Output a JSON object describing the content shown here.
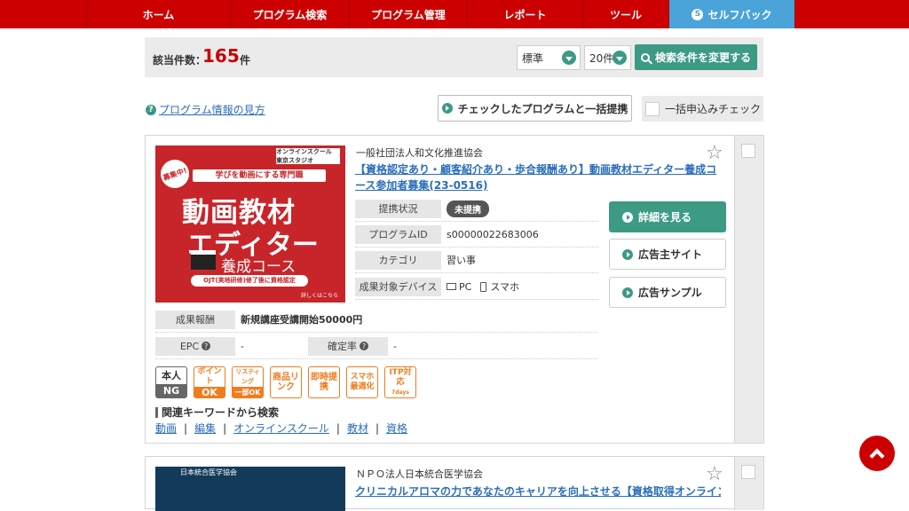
{
  "nav": {
    "items": [
      {
        "label": "ホーム"
      },
      {
        "label": "プログラム検索"
      },
      {
        "label": "プログラム管理"
      },
      {
        "label": "レポート"
      },
      {
        "label": "ツール"
      },
      {
        "label": "セルフバック",
        "icon": "self-back-icon",
        "active": true
      }
    ]
  },
  "results": {
    "label": "該当件数：",
    "count": "165",
    "unit": "件",
    "sort_value": "標準",
    "per_page_value": "20件",
    "search_button": "検索条件を変更する"
  },
  "toolbar": {
    "help_link": "プログラム情報の見方",
    "bulk_partner_button": "チェックしたプログラムと一括提携",
    "bulk_apply_check": "一括申込みチェック"
  },
  "card1": {
    "thumbnail": {
      "badge": "募集中!",
      "logo": "オンラインスクール 東京スタジオ",
      "sub": "学びを動画にする専門職",
      "line1": "動画教材",
      "line2": "エディター",
      "line3": "養成コース",
      "note": "OJT(実地研修)修了後に資格認定",
      "more": "詳しくはこちら"
    },
    "advertiser": "一般社団法人和文化推進協会",
    "title": "【資格認定あり・顧客紹介あり・歩合報酬あり】動画教材エディター養成コース参加者募集(23-0516)",
    "fields": {
      "status_key": "提携状況",
      "status_val": "未提携",
      "pid_key": "プログラムID",
      "pid_val": "s00000022683006",
      "category_key": "カテゴリ",
      "category_val": "習い事",
      "device_key": "成果対象デバイス",
      "device_pc": "PC",
      "device_sp": "スマホ",
      "reward_key": "成果報酬",
      "reward_val": "新規講座受講開始50000円",
      "epc_key": "EPC",
      "epc_val": "-",
      "rate_key": "確定率",
      "rate_val": "-"
    },
    "actions": {
      "detail": "詳細を見る",
      "site": "広告主サイト",
      "sample": "広告サンプル"
    },
    "badges": {
      "self_top": "本人",
      "self_bot": "NG",
      "point_top": "ポイント",
      "point_bot": "OK",
      "listing_top": "リスティング",
      "listing_bot": "一部OK",
      "product": "商品リンク",
      "instant": "即時提携",
      "sp": "スマホ最適化",
      "itp": "ITP対応",
      "itp_days": "7days"
    },
    "keywords": {
      "heading": "関連キーワードから検索",
      "items": [
        "動画",
        "編集",
        "オンラインスクール",
        "教材",
        "資格"
      ],
      "separator": "|"
    }
  },
  "card2": {
    "thumbnail_text": "日本統合医学協会",
    "advertiser": "ＮＰＯ法人日本統合医学協会",
    "title": "クリニカルアロマの力であなたのキャリアを向上させる【資格取得オンライン講"
  },
  "colors": {
    "brand_red": "#cc0000",
    "accent_green": "#3c9a85",
    "self_back_blue": "#4aa3d9",
    "badge_orange": "#f07c1e"
  }
}
